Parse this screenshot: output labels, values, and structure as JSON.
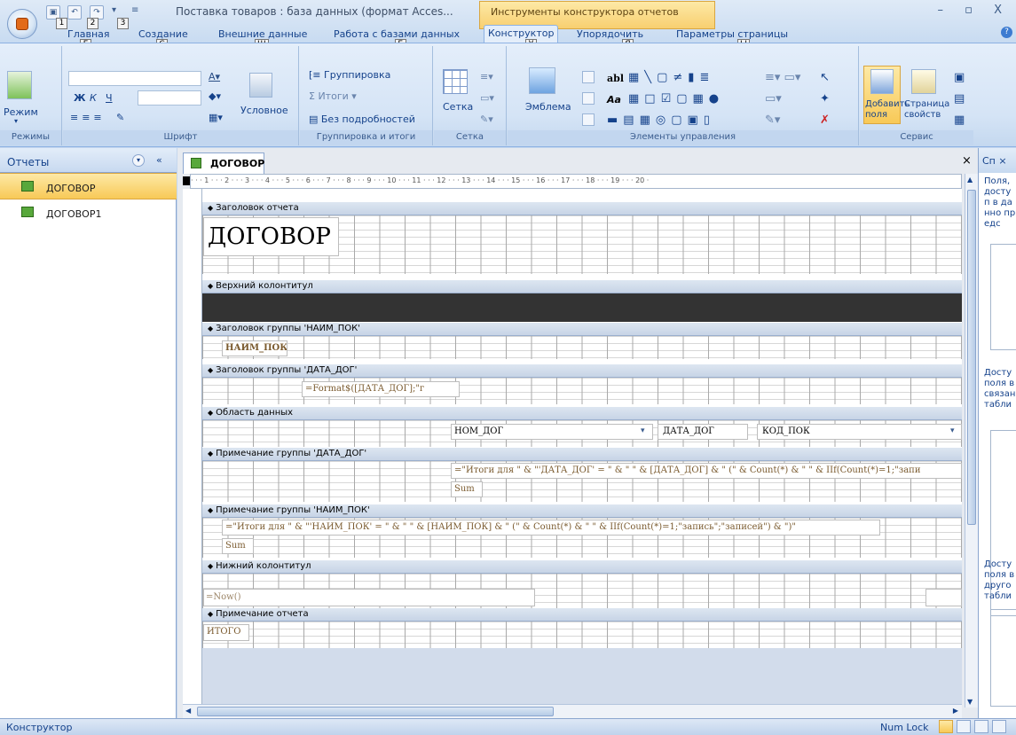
{
  "window": {
    "title": "Поставка товаров : база данных (формат Acces...",
    "tools_title": "Инструменты конструктора отчетов",
    "controls": "–  ▫  X"
  },
  "qat": {
    "keytips": [
      "1",
      "2",
      "3"
    ]
  },
  "tabs": [
    {
      "label": "Главная",
      "key": "Г"
    },
    {
      "label": "Создание",
      "key": "С"
    },
    {
      "label": "Внешние данные",
      "key": "Ш"
    },
    {
      "label": "Работа с базами данных",
      "key": "Б"
    },
    {
      "label": "Конструктор",
      "key": "У"
    },
    {
      "label": "Упорядочить",
      "key": "Я"
    },
    {
      "label": "Параметры страницы",
      "key": "Ы"
    }
  ],
  "ribbon": {
    "modes": {
      "button": "Режим",
      "group": "Режимы"
    },
    "font": {
      "group": "Шрифт",
      "cond": "Условное",
      "bold": "Ж",
      "italic": "К",
      "underline": "Ч"
    },
    "grouping": {
      "group": "Группировка и итоги",
      "grouping": "Группировка",
      "totals": "Итоги",
      "hide_details": "Без подробностей"
    },
    "grid": {
      "group": "Сетка",
      "label": "Сетка"
    },
    "controls": {
      "group": "Элементы управления",
      "emblem": "Эмблема",
      "textbox": "abl",
      "label": "Aa"
    },
    "service": {
      "group": "Сервис",
      "add_fields": "Добавить поля",
      "props": "Страница свойств"
    }
  },
  "nav": {
    "title": "Отчеты",
    "items": [
      {
        "label": "ДОГОВОР"
      },
      {
        "label": "ДОГОВОР1"
      }
    ]
  },
  "doc": {
    "tab": "ДОГОВОР",
    "ruler": "· · · 1 · · · 2 · · · 3 · · · 4 · · · 5 · · · 6 · · · 7 · · · 8 · · · 9 · · · 10 · · · 11 · · · 12 · · · 13 · · · 14 · · · 15 · · · 16 · · · 17 · · · 18 · · · 19 · · · 20 ·",
    "bands": {
      "report_header": "Заголовок отчета",
      "page_header": "Верхний колонтитул",
      "group1_header": "Заголовок группы 'НАИМ_ПОК'",
      "group2_header": "Заголовок группы 'ДАТА_ДОГ'",
      "detail": "Область данных",
      "group2_footer": "Примечание группы 'ДАТА_ДОГ'",
      "group1_footer": "Примечание группы 'НАИМ_ПОК'",
      "page_footer": "Нижний колонтитул",
      "report_footer": "Примечание отчета"
    },
    "controls": {
      "title": "ДОГОВОР",
      "naim": "НАИМ_ПОК",
      "format": "=Format$([ДАТА_ДОГ];\"г",
      "nom": "НОМ_ДОГ",
      "data": "ДАТА_ДОГ",
      "kod": "КОД_ПОК",
      "totals2": "=\"Итоги для \" & \"'ДАТА_ДОГ' = \" & \" \" & [ДАТА_ДОГ] & \" (\" & Count(*) & \" \" & IIf(Count(*)=1;\"запи",
      "sum2": "Sum",
      "totals1": "=\"Итоги для \" & \"'НАИМ_ПОК' = \" & \" \" & [НАИМ_ПОК] & \" (\" & Count(*) & \" \" & IIf(Count(*)=1;\"запись\";\"записей\") & \")\"",
      "sum1": "Sum",
      "now": "=Now()",
      "itogo": "ИТОГО"
    }
  },
  "rightpane": {
    "title": "Сп",
    "text1": "Поля, доступ в данно предс",
    "text2": "Досту поля в связан табли",
    "text3": "Досту поля в друго табли"
  },
  "status": {
    "mode": "Конструктор",
    "numlock": "Num Lock"
  }
}
